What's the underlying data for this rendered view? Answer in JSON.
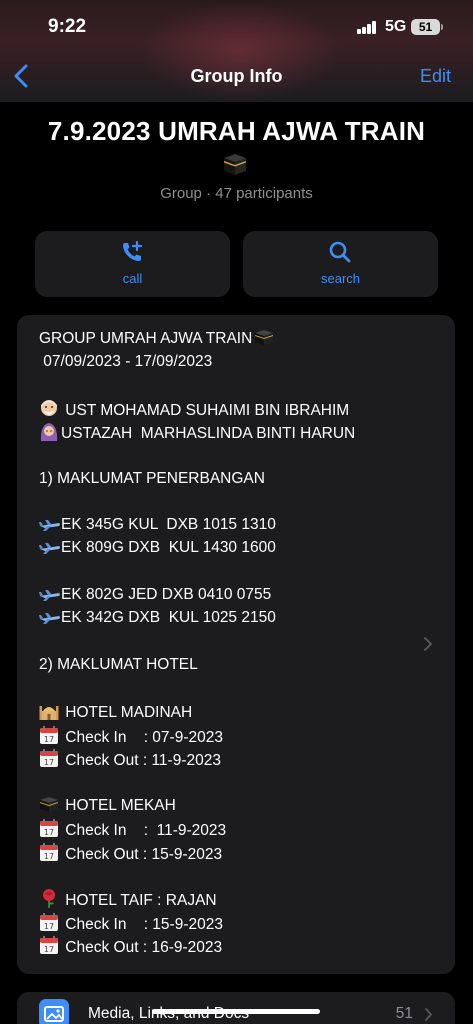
{
  "status_bar": {
    "time": "9:22",
    "network": "5G",
    "battery": "51"
  },
  "nav": {
    "title": "Group Info",
    "edit_label": "Edit"
  },
  "group": {
    "name": "7.9.2023 UMRAH AJWA TRAIN",
    "participants": "Group · 47 participants"
  },
  "actions": [
    {
      "label": "call",
      "icon": "phone-add-icon"
    },
    {
      "label": "search",
      "icon": "search-icon"
    }
  ],
  "description": [
    {
      "text": "GROUP UMRAH AJWA TRAIN",
      "emoji_after": "kaaba-icon"
    },
    {
      "text": " 07/09/2023 - 17/09/2023"
    },
    {
      "text": ""
    },
    {
      "text": " UST MOHAMAD SUHAIMI BIN IBRAHIM",
      "emoji_before": "old-man-icon"
    },
    {
      "text": "USTAZAH  MARHASLINDA BINTI HARUN",
      "emoji_before": "woman-headscarf-icon"
    },
    {
      "text": ""
    },
    {
      "text": "1) MAKLUMAT PENERBANGAN"
    },
    {
      "text": ""
    },
    {
      "text": "EK 345G KUL  DXB 1015 1310",
      "emoji_before": "airplane-icon"
    },
    {
      "text": "EK 809G DXB  KUL 1430 1600",
      "emoji_before": "airplane-icon"
    },
    {
      "text": ""
    },
    {
      "text": "EK 802G JED DXB 0410 0755",
      "emoji_before": "airplane-icon"
    },
    {
      "text": "EK 342G DXB  KUL 1025 2150",
      "emoji_before": "airplane-icon"
    },
    {
      "text": ""
    },
    {
      "text": "2) MAKLUMAT HOTEL"
    },
    {
      "text": ""
    },
    {
      "text": " HOTEL MADINAH",
      "emoji_before": "mosque-icon"
    },
    {
      "text": " Check In    : 07-9-2023",
      "emoji_before": "calendar-icon"
    },
    {
      "text": " Check Out : 11-9-2023",
      "emoji_before": "calendar-icon"
    },
    {
      "text": ""
    },
    {
      "text": " HOTEL MEKAH",
      "emoji_before": "kaaba-icon"
    },
    {
      "text": " Check In    :  11-9-2023",
      "emoji_before": "calendar-icon"
    },
    {
      "text": " Check Out : 15-9-2023",
      "emoji_before": "calendar-icon"
    },
    {
      "text": ""
    },
    {
      "text": " HOTEL TAIF : RAJAN",
      "emoji_before": "rose-icon"
    },
    {
      "text": " Check In    : 15-9-2023",
      "emoji_before": "calendar-icon"
    },
    {
      "text": " Check Out : 16-9-2023",
      "emoji_before": "calendar-icon"
    }
  ],
  "media": {
    "label": "Media, Links, and Docs",
    "count": "51"
  },
  "colors": {
    "accent": "#3d8ef7",
    "card": "#1c1c1e",
    "secondary_text": "#8e8e93"
  }
}
